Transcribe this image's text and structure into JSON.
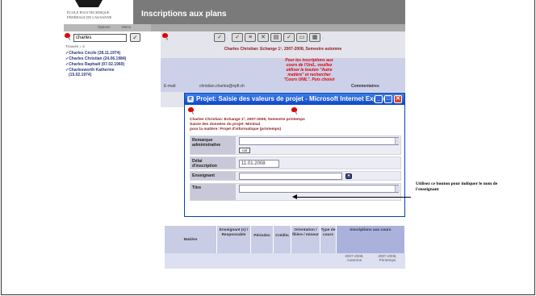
{
  "header": {
    "logo_line1": "ÉCOLE POLYTECHNIQUE",
    "logo_line2": "FÉDÉRALE DE LAUSANNE",
    "app_title": "Inscriptions aux plans",
    "subnav": [
      "Options",
      "Menu"
    ]
  },
  "left_panel": {
    "search_value": "charles",
    "ok_label": "✓",
    "found_text": "Trouvés = 4",
    "people": [
      "✓Charles Cécile (28.11.1974)",
      "✓Charles Christian (24.06.1984)",
      "✓Charles Raphaël (07.02.1969)",
      "✓Charlesworth Katherine",
      "(15.02.1974)"
    ]
  },
  "pane": {
    "course_title": "Charles Christian: Echange 1º, 2007-2008, Semestre automne",
    "note_lines": [
      "Pour les inscriptions aux",
      "cours de l'UniL, veuillez",
      "utiliser le bouton \"Autre",
      "matière\" et rechercher",
      "\"Cours UNIL\". Puis choisir"
    ],
    "email_label": "E-mail:",
    "email_value": "christian.charles@epfl.ch",
    "comments_label": "Commentaires"
  },
  "dialog": {
    "title": "Projet: Saisie des valeurs de projet - Microsoft Internet Explorer",
    "head_lines": [
      "Charles Christian: Echange 1º, 2007-2008, Semestre printemps",
      "Saisie des données du projet: Minimal",
      "pour la matière: Projet d'informatique (printemps)"
    ],
    "fields": {
      "remark_label_1": "Remarque",
      "remark_label_2": "administrative",
      "cal_label": "cal",
      "delay_label_1": "Délai",
      "delay_label_2": "d'inscription",
      "delay_value": "11.01.2008",
      "teacher_label": "Enseignant",
      "title_label": "Titre"
    }
  },
  "table": {
    "headers": [
      "Matière",
      "Enseignant (s) / Responsable",
      "Périodes",
      "Crédits",
      "Orientation / filière / mineur",
      "Type de cours",
      "Inscriptions aux cours"
    ],
    "years": [
      "2007-2008, Automne",
      "2007-2008, Printemps"
    ]
  },
  "annotation": {
    "text": "Utilisez ce bouton pour indiquer le nom de l'enseignant"
  }
}
